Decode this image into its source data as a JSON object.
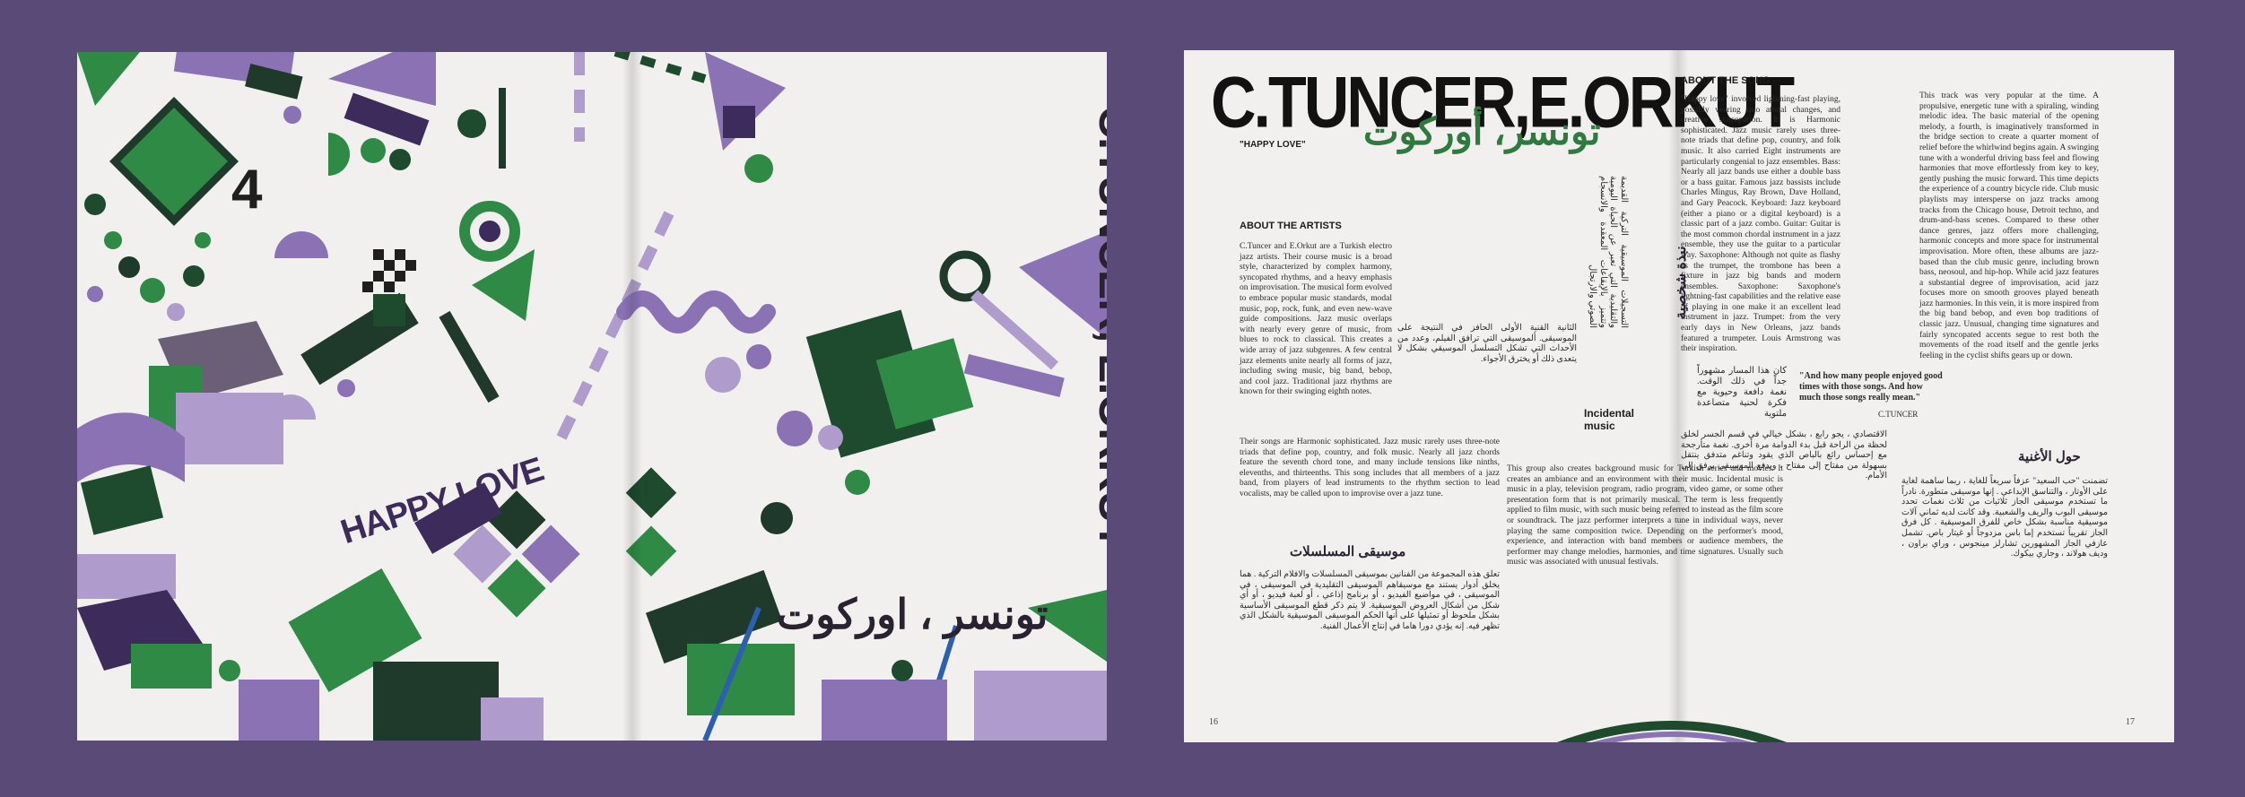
{
  "cover": {
    "badge_number": "4",
    "title_vertical": "C.TUNCER, E.ORKUT",
    "subtitle": "HAPPY LOVE",
    "arabic_title": "تونسر ، اوركوت"
  },
  "spread": {
    "header_title": "C.TUNCER,E.ORKUT",
    "header_arabic": "تونسر، أوركوت",
    "song_label": "\"HAPPY LOVE\"",
    "about_artists_heading": "ABOUT THE ARTISTS",
    "about_artists_text": "C.Tuncer and E.Orkut are a Turkish electro jazz artists. Their course music is a broad style, characterized by complex harmony, syncopated rhythms, and a heavy emphasis on improvisation. The musical form evolved to embrace popular music standards, modal music, pop, rock, funk, and even new-wave guide compositions. Jazz music overlaps with nearly every genre of music, from blues to rock to classical. This creates a wide array of jazz subgenres. A few central jazz elements unite nearly all forms of jazz, including swing music, big band, bebop, and cool jazz. Traditional jazz rhythms are known for their swinging eighth notes.",
    "about_artists_text2": "Their songs are Harmonic sophisticated. Jazz music rarely uses three-note triads that define pop, country, and folk music. Nearly all jazz chords feature the seventh chord tone, and many include tensions like ninths, elevenths, and thirteenths. This song includes that all members of a jazz band, from players of lead instruments to the rhythm section to lead vocalists, may be called upon to improvise over a jazz tune.",
    "arabic_heading_series": "موسيقى المسلسلات",
    "arabic_series_text": "تعلق هذه المجموعة من الفنانين بموسيقى المسلسلات والافلام التركية . هما يخلق أدوار يستند مع موسيقاهم الموسيقى التقليدية في الموسيقى ، في الموسيقى ، في مواضيع الفيديو ، أو برنامج إذاعي ، أو لعبة فيديو ، أو أي شكل من أشكال العروض الموسيقية. لا يتم ذكر قطع الموسيقى الأساسية بشكل ملحوظ أو تمثيلها على أنها الحكم الموسيقى الموسيقية بالشكل الذي تظهر فيه. إنه يؤدي دورا هاما في إنتاج الأعمال الفنية.",
    "incidental_heading": "Incidental music",
    "incidental_arabic_text": "الثانية القنية الأولى الحافز في النتيجة على الموسيقى. ألموسيقى التي ترافق الفيلم، وعدد من الأحداث التي تشكل التسلسل الموسيقي بشكل لا يتعدى ذلك أو يخترق الأجواء.",
    "incidental_text": "This group also creates background music for Turkish series and movies. It creates an ambiance and an environment with their music. Incidental music is music in a play, television program, radio program, video game, or some other presentation form that is not primarily musical. The term is less frequently applied to film music, with such music being referred to instead as the film score or soundtrack. The jazz performer interprets a tune in individual ways, never playing the same composition twice. Depending on the performer's mood, experience, and interaction with band members or audience members, the performer may change melodies, harmonies, and time signatures. Usually such music was associated with unusual festivals.",
    "about_song_heading": "ABOUT THE SONG",
    "about_song_text": "\"Happy love\" involved lightning-fast playing, possibly veering into atonal changes, and creative syncopation. It is Harmonic sophisticated. Jazz music rarely uses three-note triads that define pop, country, and folk music. It also carried Eight instruments are particularly congenial to jazz ensembles. Bass: Nearly all jazz bands use either a double bass or a bass guitar. Famous jazz bassists include Charles Mingus, Ray Brown, Dave Holland, and Gary Peacock. Keyboard: Jazz keyboard (either a piano or a digital keyboard) is a classic part of a jazz combo. Guitar: Guitar is the most common chordal instrument in a jazz ensemble, they use the guitar to a particular way. Saxophone: Although not quite as flashy as the trumpet, the trombone has been a fixture in jazz big bands and modern ensembles. Saxophone: Saxophone's lightning-fast capabilities and the relative ease of playing in one make it an excellent lead instrument in jazz. Trumpet: from the very early days in New Orleans, jazz bands featured a trumpeter. Louis Armstrong was their inspiration.",
    "col4_text": "This track was very popular at the time. A propulsive, energetic tune with a spiraling, winding melodic idea. The basic material of the opening melody, a fourth, is imaginatively transformed in the bridge section to create a quarter moment of relief before the whirlwind begins again. A swinging tune with a wonderful driving bass feel and flowing harmonies that move effortlessly from key to key, gently pushing the music forward. This time depicts the experience of a country bicycle ride. Club music playlists may intersperse on jazz tracks among tracks from the Chicago house, Detroit techno, and drum-and-bass scenes. Compared to these other dance genres, jazz offers more challenging, harmonic concepts and more space for instrumental improvisation. More often, these albums are jazz-based than the club music genre, including brown bass, neosoul, and hip-hop. While acid jazz features a substantial degree of improvisation, acid jazz focuses more on smooth grooves played beneath jazz harmonies. In this vein, it is more inspired from the big band bebop, and even bop traditions of classic jazz. Unusual, changing time signatures and fairly syncopated accents segue to rest both the movements of the road itself and the gentle jerks feeling in the cyclist shifts gears up or down.",
    "vertical_arabic_heading": "نبذة شخصية",
    "quote_arabic": "كان هذا المسار مشهوراً جداً في ذلك الوقت. نغمة دافعة وحيوية مع فكرة لحنية متصاعدة ملتوية",
    "quote_english": "\"And how many people enjoyed good times with those songs. And how much those songs really mean.\"",
    "quote_author": "C.TUNCER",
    "arabic_heading_song": "حول الأغنية",
    "arabic_song_text": "تضمنت \"حب السعيد\" عزفاً سريعاً للغاية ، ربما ساهمة لغاية على الأوتار ، والتناسق الإبداعي . إنها موسيقى متطورة. نادراً ما تستخدم موسيقى الجاز ثلاثيات من ثلاث نغمات تحدد موسيقى البوب والريف والشعبية. وقد كانت لديه ثماني آلات موسيقية مناسبة بشكل خاص للفرق الموسيقية . كل فرق الجاز تقريباً تستخدم إما باس مزدوجاً أو غيتار باص. تشمل عازفي الجاز المشهورين تشارلز مينجوس ، وراي براون ، وديف هولاند ، وجاري بيكوك.",
    "arabic_mid_text": "الاقتصادي ، يجو رابع ، بشكل خيالي في قسم الجسر لخلق لحظة من الراحة قبل بدء الدوامة مرة أخرى. نغمة متأرجحة مع إحساس رائع بالباص الذي يقود وتناغم متدفق ينتقل بسهولة من مفتاح إلى مفتاح ، ويدفع الموسيقى برفق إلى الأمام.",
    "vertical_arabic_column": "التسجيلات الموسيقية التركية القديمة والتقليدية التي تعبر عن الحياة اليومية وتتميز بالإيقاعات المعقدة والانسجام الصوتي والارتجال",
    "page_left": "16",
    "page_right": "17"
  },
  "palette": {
    "purple": "#8b72b5",
    "lavender": "#b09ccc",
    "dark_purple": "#3c2b5b",
    "green": "#2f8a46",
    "dark_green": "#1e4a2e",
    "deep_green": "#1f3a2a",
    "blue": "#2d5fb0",
    "paper": "#f1f0ee",
    "background": "#5a4a78"
  }
}
